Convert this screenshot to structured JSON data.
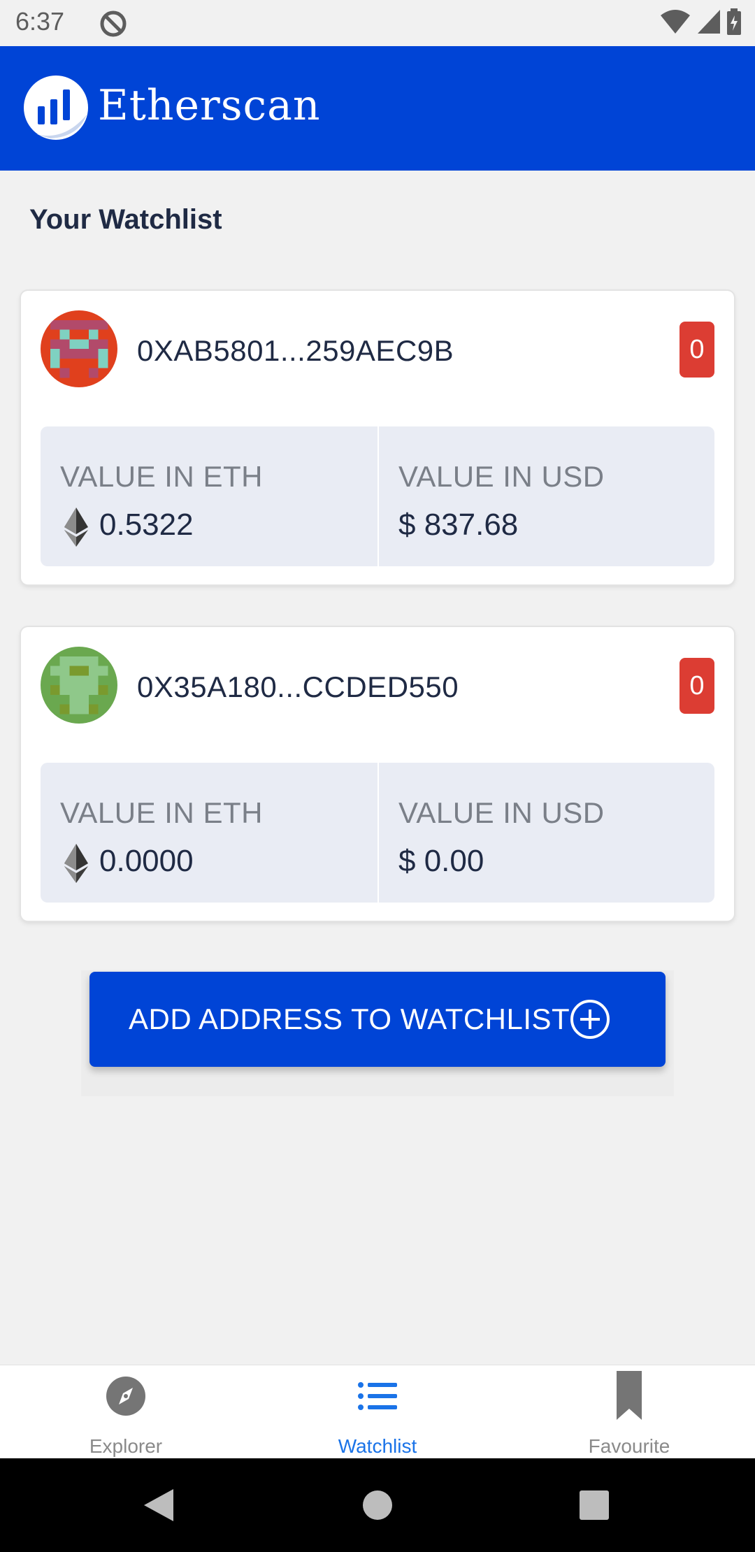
{
  "status_bar": {
    "time": "6:37"
  },
  "header": {
    "brand": "Etherscan"
  },
  "page": {
    "title": "Your Watchlist"
  },
  "watchlist": [
    {
      "address": "0XAB5801...259AEC9B",
      "badge_count": "0",
      "eth_label": "VALUE IN ETH",
      "eth_value": "0.5322",
      "usd_label": "VALUE IN USD",
      "usd_value": "$ 837.68"
    },
    {
      "address": "0X35A180...CCDED550",
      "badge_count": "0",
      "eth_label": "VALUE IN ETH",
      "eth_value": "0.0000",
      "usd_label": "VALUE IN USD",
      "usd_value": "$ 0.00"
    }
  ],
  "add_button": {
    "label": "ADD ADDRESS TO WATCHLIST"
  },
  "bottom_nav": {
    "items": [
      {
        "label": "Explorer",
        "icon": "compass-icon",
        "active": false
      },
      {
        "label": "Watchlist",
        "icon": "list-icon",
        "active": true
      },
      {
        "label": "Favourite",
        "icon": "bookmark-icon",
        "active": false
      }
    ]
  },
  "colors": {
    "brand_blue": "#0044d6",
    "badge_red": "#dc3d33",
    "active_nav": "#1a73e8"
  }
}
